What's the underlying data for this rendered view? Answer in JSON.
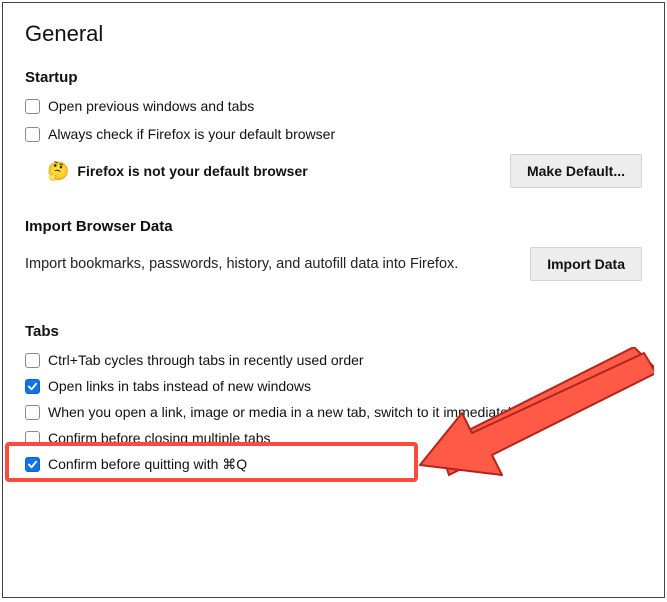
{
  "page_title": "General",
  "startup": {
    "title": "Startup",
    "open_previous": {
      "label": "Open previous windows and tabs",
      "checked": false
    },
    "always_check": {
      "label": "Always check if Firefox is your default browser",
      "checked": false
    },
    "not_default_msg": "Firefox is not your default browser",
    "make_default_btn": "Make Default..."
  },
  "import": {
    "title": "Import Browser Data",
    "description": "Import bookmarks, passwords, history, and autofill data into Firefox.",
    "btn": "Import Data"
  },
  "tabs": {
    "title": "Tabs",
    "ctrl_tab": {
      "label": "Ctrl+Tab cycles through tabs in recently used order",
      "checked": false
    },
    "open_links": {
      "label": "Open links in tabs instead of new windows",
      "checked": true
    },
    "switch_to": {
      "label": "When you open a link, image or media in a new tab, switch to it immediately",
      "checked": false
    },
    "confirm_close": {
      "label": "Confirm before closing multiple tabs",
      "checked": false
    },
    "confirm_quit": {
      "label": "Confirm before quitting with ⌘Q",
      "checked": true
    }
  },
  "annotation": {
    "highlighted_option": "open_links"
  }
}
